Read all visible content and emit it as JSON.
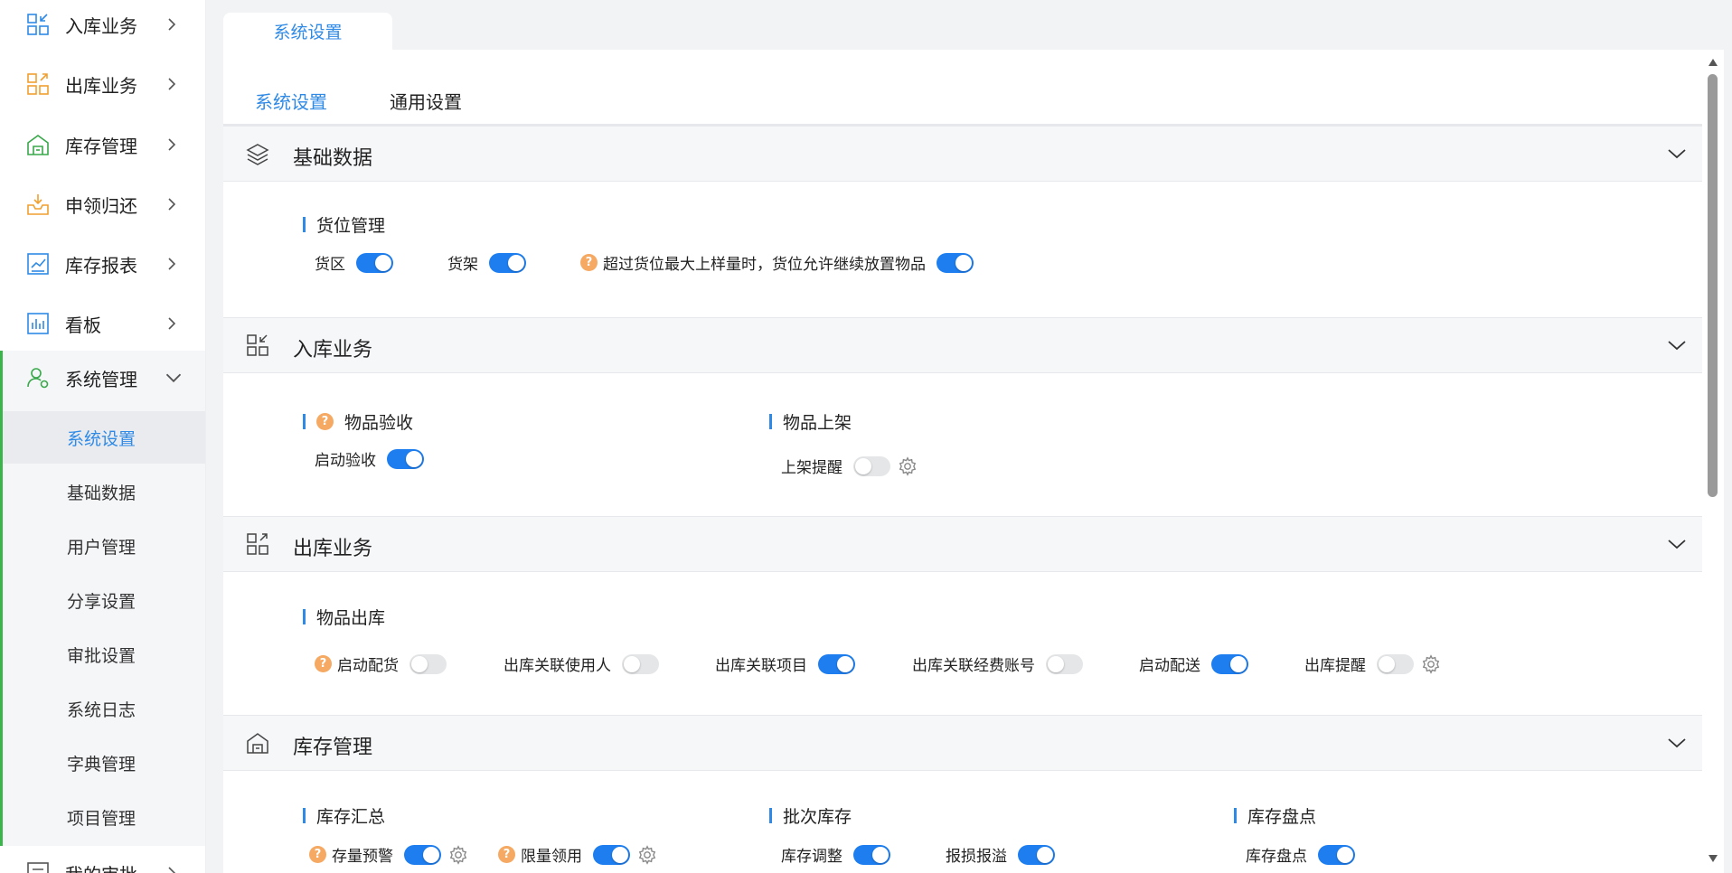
{
  "sidebar": {
    "items": [
      {
        "label": "入库业务",
        "icon": "inbound-icon"
      },
      {
        "label": "出库业务",
        "icon": "outbound-icon"
      },
      {
        "label": "库存管理",
        "icon": "warehouse-icon"
      },
      {
        "label": "申领归还",
        "icon": "tray-download-icon"
      },
      {
        "label": "库存报表",
        "icon": "chart-report-icon"
      },
      {
        "label": "看板",
        "icon": "dashboard-icon"
      }
    ],
    "system": {
      "label": "系统管理",
      "children": [
        "系统设置",
        "基础数据",
        "用户管理",
        "分享设置",
        "审批设置",
        "系统日志",
        "字典管理",
        "项目管理"
      ],
      "active_child": "系统设置"
    },
    "next_item": {
      "label": "我的审批"
    }
  },
  "top_tabs": [
    {
      "label": "系统设置"
    }
  ],
  "sub_tabs": [
    {
      "label": "系统设置",
      "active": true
    },
    {
      "label": "通用设置",
      "active": false
    }
  ],
  "sections": {
    "basic": {
      "title": "基础数据",
      "groups": [
        {
          "title": "货位管理",
          "options": [
            {
              "label": "货区",
              "on": true
            },
            {
              "label": "货架",
              "on": true
            },
            {
              "label": "超过货位最大上样量时，货位允许继续放置物品",
              "on": true,
              "help": true
            }
          ]
        }
      ]
    },
    "inbound": {
      "title": "入库业务",
      "groups": [
        {
          "title": "物品验收",
          "help": true,
          "options": [
            {
              "label": "启动验收",
              "on": true
            }
          ]
        },
        {
          "title": "物品上架",
          "options": [
            {
              "label": "上架提醒",
              "on": false,
              "gear": true
            }
          ]
        }
      ]
    },
    "outbound": {
      "title": "出库业务",
      "groups": [
        {
          "title": "物品出库",
          "options": [
            {
              "label": "启动配货",
              "on": false,
              "help": true
            },
            {
              "label": "出库关联使用人",
              "on": false
            },
            {
              "label": "出库关联项目",
              "on": true
            },
            {
              "label": "出库关联经费账号",
              "on": false
            },
            {
              "label": "启动配送",
              "on": true
            },
            {
              "label": "出库提醒",
              "on": false,
              "gear": true
            }
          ]
        }
      ]
    },
    "inventory": {
      "title": "库存管理",
      "groups": [
        {
          "title": "库存汇总",
          "options": [
            {
              "label": "存量预警",
              "on": true,
              "help": true,
              "gear": true
            },
            {
              "label": "限量领用",
              "on": true,
              "help": true,
              "gear": true
            }
          ]
        },
        {
          "title": "批次库存",
          "options": [
            {
              "label": "库存调整",
              "on": true
            },
            {
              "label": "报损报溢",
              "on": true
            }
          ]
        },
        {
          "title": "库存盘点",
          "options": [
            {
              "label": "库存盘点",
              "on": true
            }
          ]
        }
      ]
    }
  },
  "colors": {
    "accent": "#2f8ae6",
    "toggle_on": "#1e7ef0",
    "toggle_off": "#e5e6e8",
    "help": "#f5a962",
    "sidebar_active_bar": "#39b54a"
  }
}
